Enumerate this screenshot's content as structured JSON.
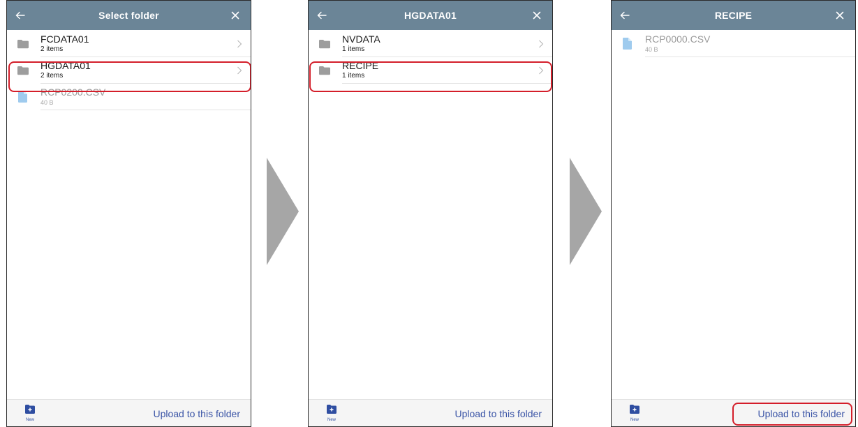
{
  "colors": {
    "header_bg": "#6b8597",
    "highlight": "#d41e2a",
    "link": "#3a54a6",
    "folder_icon": "#9d9d9d",
    "file_icon": "#9fcbee",
    "step_arrow": "#a6a6a6"
  },
  "screens": [
    {
      "title": "Select folder",
      "items": [
        {
          "type": "folder",
          "name": "FCDATA01",
          "sub": "2 items",
          "icon": "folder-icon"
        },
        {
          "type": "folder",
          "name": "HGDATA01",
          "sub": "2 items",
          "icon": "folder-icon"
        },
        {
          "type": "file",
          "name": "RCP0200.CSV",
          "sub": "40 B",
          "icon": "file-icon"
        }
      ],
      "footer": {
        "new_label": "New",
        "upload_label": "Upload to this folder"
      }
    },
    {
      "title": "HGDATA01",
      "items": [
        {
          "type": "folder",
          "name": "NVDATA",
          "sub": "1 items",
          "icon": "folder-icon"
        },
        {
          "type": "folder",
          "name": "RECIPE",
          "sub": "1 items",
          "icon": "folder-icon"
        }
      ],
      "footer": {
        "new_label": "New",
        "upload_label": "Upload to this folder"
      }
    },
    {
      "title": "RECIPE",
      "items": [
        {
          "type": "file",
          "name": "RCP0000.CSV",
          "sub": "40 B",
          "icon": "file-icon"
        }
      ],
      "footer": {
        "new_label": "New",
        "upload_label": "Upload to this folder"
      }
    }
  ],
  "icons": {
    "back": "arrow-left-icon",
    "close": "close-icon",
    "chevron": "chevron-right-icon",
    "new_folder": "new-folder-icon",
    "step": "step-arrow-icon"
  }
}
